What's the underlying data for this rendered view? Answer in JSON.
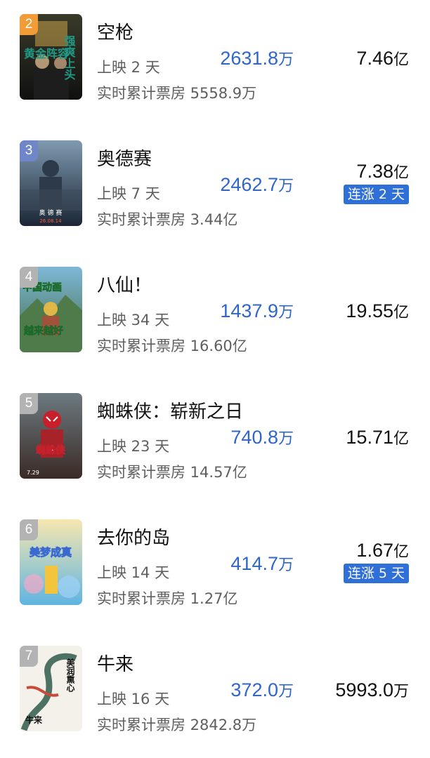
{
  "movies": [
    {
      "rank": "2",
      "title": "空枪",
      "days": "上映 2 天",
      "total": "实时累计票房 5558.9万",
      "daily_value": "2631.8",
      "daily_unit": "万",
      "cumulative_value": "7.46",
      "cumulative_unit": "亿",
      "streak": "",
      "poster": {
        "texts": [
          "黄金阵容",
          "强爽上头"
        ],
        "bg_top": "#3a3a2a",
        "bg_bottom": "#101010",
        "accent": "#c9a24a",
        "text_color": "#1f9a86"
      },
      "badge_color": "#f29c38"
    },
    {
      "rank": "3",
      "title": "奥德赛",
      "days": "上映 7 天",
      "total": "实时累计票房 3.44亿",
      "daily_value": "2462.7",
      "daily_unit": "万",
      "cumulative_value": "7.38",
      "cumulative_unit": "亿",
      "streak": "连涨 2 天",
      "poster": {
        "texts": [
          "奥 德 赛",
          "26.08.14"
        ],
        "bg_top": "#7f9ab0",
        "bg_bottom": "#1b2634",
        "accent": "#2d3a4a",
        "text_color": "#ffffff"
      },
      "badge_color": "#6f86c9"
    },
    {
      "rank": "4",
      "title": "八仙！",
      "days": "上映 34 天",
      "total": "实时累计票房 16.60亿",
      "daily_value": "1437.9",
      "daily_unit": "万",
      "cumulative_value": "19.55",
      "cumulative_unit": "亿",
      "streak": "",
      "poster": {
        "texts": [
          "中国动画",
          "越来越好"
        ],
        "bg_top": "#7fb8d8",
        "bg_bottom": "#3f6b43",
        "accent": "#e0b84a",
        "text_color": "#ffffff"
      },
      "badge_color": "#b3b3b3"
    },
    {
      "rank": "5",
      "title": "蜘蛛侠：崭新之日",
      "days": "上映 23 天",
      "total": "实时累计票房 14.57亿",
      "daily_value": "740.8",
      "daily_unit": "万",
      "cumulative_value": "15.71",
      "cumulative_unit": "亿",
      "streak": "",
      "poster": {
        "texts": [
          "蜘蛛侠",
          "7.29"
        ],
        "bg_top": "#6d7a80",
        "bg_bottom": "#3a2a26",
        "accent": "#c8202a",
        "text_color": "#ffffff"
      },
      "badge_color": "#b3b3b3"
    },
    {
      "rank": "6",
      "title": "去你的岛",
      "days": "上映 14 天",
      "total": "实时累计票房 1.27亿",
      "daily_value": "414.7",
      "daily_unit": "万",
      "cumulative_value": "1.67",
      "cumulative_unit": "亿",
      "streak": "连涨 5 天",
      "poster": {
        "texts": [
          "美梦成真"
        ],
        "bg_top": "#f7e7b0",
        "bg_bottom": "#5fb4e0",
        "accent": "#f2c53d",
        "text_color": "#f0a020"
      },
      "badge_color": "#b3b3b3"
    },
    {
      "rank": "7",
      "title": "牛来",
      "days": "上映 16 天",
      "total": "实时累计票房 2842.8万",
      "daily_value": "372.0",
      "daily_unit": "万",
      "cumulative_value": "5993.0",
      "cumulative_unit": "万",
      "streak": "",
      "poster": {
        "texts": [
          "美润熏心",
          "牛来"
        ],
        "bg_top": "#f4f1ea",
        "bg_bottom": "#e6e1d6",
        "accent": "#2f5a4a",
        "text_color": "#111111"
      },
      "badge_color": "#b3b3b3"
    }
  ]
}
